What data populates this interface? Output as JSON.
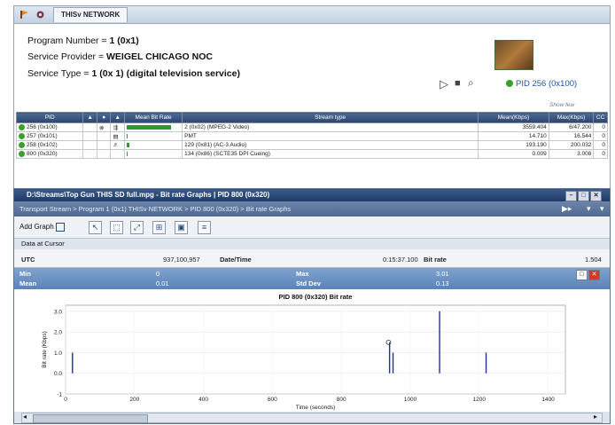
{
  "top": {
    "tab_title": "THISv NETWORK",
    "program_number_label": "Program Number = ",
    "program_number_value": "1 (0x1)",
    "service_provider_label": "Service Provider = ",
    "service_provider_value": "WEIGEL CHICAGO NOC",
    "service_type_label": "Service Type = ",
    "service_type_value": "1 (0x 1) (digital television service)",
    "pid_link": "PID 256 (0x100)",
    "show_few": "Show few"
  },
  "table": {
    "headers": [
      "PID",
      "",
      "",
      "",
      "Mean Bit Rate",
      "Stream type",
      "Mean(Kbps)",
      "Max(Kbps)",
      "CC"
    ],
    "rows": [
      {
        "pid": "256 (0x100)",
        "stype": "2 (0x02) (MPEG-2 Video)",
        "mean": "3559.404",
        "max": "6/47.200",
        "cc": "0",
        "bar": 1.0,
        "icon": "video"
      },
      {
        "pid": "257 (0x101)",
        "stype": "PMT",
        "mean": "14.710",
        "max": "16.544",
        "cc": "0",
        "bar": 0.0,
        "icon": "table"
      },
      {
        "pid": "258 (0x102)",
        "stype": "129 (0x81) (AC-3 Audio)",
        "mean": "193.190",
        "max": "200.032",
        "cc": "0",
        "bar": 0.05,
        "icon": "audio"
      },
      {
        "pid": "800 (0x320)",
        "stype": "134 (0x86) (SCTE35 DPI Cueing)",
        "mean": "0.009",
        "max": "3.008",
        "cc": "0",
        "bar": 0.0,
        "icon": ""
      }
    ]
  },
  "graph": {
    "window_title": "D:\\Streams\\Top Gun THIS SD full.mpg - Bit rate Graphs | PID 800 (0x320)",
    "breadcrumb": "Transport Stream > Program 1 (0x1) THISv NETWORK > PID 800 (0x320) > Bit rate Graphs",
    "add_graph": "Add Graph",
    "data_at_cursor": "Data at Cursor",
    "utc_label": "UTC",
    "utc_value": "937,100,957",
    "datetime_label": "Date/Time",
    "datetime_value": "0:15:37.100",
    "bitrate_label": "Bit rate",
    "bitrate_value": "1.504",
    "min_label": "Min",
    "min_value": "0",
    "max_label": "Max",
    "max_value": "3.01",
    "mean_label": "Mean",
    "mean_value": "0.01",
    "stddev_label": "Std Dev",
    "stddev_value": "0.13",
    "chart_title": "PID 800 (0x320) Bit rate",
    "ylabel": "Bit rate (Kbps)",
    "xlabel": "Time (seconds)"
  },
  "chart_data": {
    "type": "bar",
    "title": "PID 800 (0x320) Bit rate",
    "xlabel": "Time (seconds)",
    "ylabel": "Bit rate (Kbps)",
    "xlim": [
      0,
      1450
    ],
    "ylim": [
      -1,
      3.3
    ],
    "xticks": [
      0,
      200,
      400,
      600,
      800,
      1000,
      1200,
      1400
    ],
    "yticks": [
      3,
      2,
      1,
      0,
      -1
    ],
    "ytick_labels": [
      "3.0",
      "2.0",
      "1.0",
      "0.0",
      "-1"
    ],
    "x": [
      20,
      940,
      950,
      1085,
      1220
    ],
    "values": [
      1.0,
      1.5,
      1.0,
      3.01,
      1.0
    ],
    "cursor_x": 937,
    "grid": true
  }
}
